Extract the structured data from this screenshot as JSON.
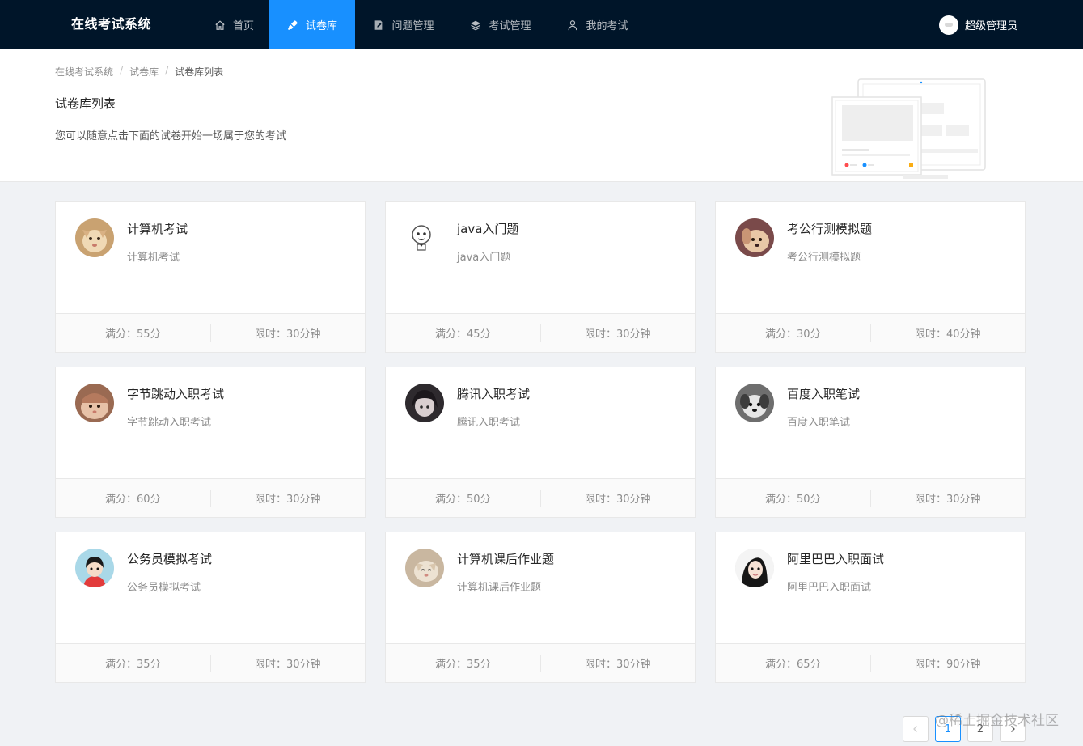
{
  "header": {
    "brand": "在线考试系统",
    "nav": [
      {
        "label": "首页",
        "icon": "home-icon"
      },
      {
        "label": "试卷库",
        "icon": "rocket-icon",
        "active": true
      },
      {
        "label": "问题管理",
        "icon": "edit-doc-icon"
      },
      {
        "label": "考试管理",
        "icon": "stack-icon"
      },
      {
        "label": "我的考试",
        "icon": "user-icon"
      }
    ],
    "user_name": "超级管理员",
    "accent_color": "#1890ff",
    "bar_color": "#001529"
  },
  "breadcrumb": [
    "在线考试系统",
    "试卷库",
    "试卷库列表"
  ],
  "page_title": "试卷库列表",
  "page_desc": "您可以随意点击下面的试卷开始一场属于您的考试",
  "cards": [
    {
      "title": "计算机考试",
      "desc": "计算机考试",
      "score": "满分：55分",
      "time": "限时：30分钟",
      "avatar": "cat-avatar"
    },
    {
      "title": "java入门题",
      "desc": "java入门题",
      "score": "满分：45分",
      "time": "限时：30分钟",
      "avatar": "cartoon-avatar"
    },
    {
      "title": "考公行测模拟题",
      "desc": "考公行测模拟题",
      "score": "满分：30分",
      "time": "限时：40分钟",
      "avatar": "dog-avatar"
    },
    {
      "title": "字节跳动入职考试",
      "desc": "字节跳动入职考试",
      "score": "满分：60分",
      "time": "限时：30分钟",
      "avatar": "hamster-avatar"
    },
    {
      "title": "腾讯入职考试",
      "desc": "腾讯入职考试",
      "score": "满分：50分",
      "time": "限时：30分钟",
      "avatar": "anime-avatar"
    },
    {
      "title": "百度入职笔试",
      "desc": "百度入职笔试",
      "score": "满分：50分",
      "time": "限时：30分钟",
      "avatar": "puppy-avatar"
    },
    {
      "title": "公务员模拟考试",
      "desc": "公务员模拟考试",
      "score": "满分：35分",
      "time": "限时：30分钟",
      "avatar": "girl-avatar"
    },
    {
      "title": "计算机课后作业题",
      "desc": "计算机课后作业题",
      "score": "满分：35分",
      "time": "限时：30分钟",
      "avatar": "kitten-avatar"
    },
    {
      "title": "阿里巴巴入职面试",
      "desc": "阿里巴巴入职面试",
      "score": "满分：65分",
      "time": "限时：90分钟",
      "avatar": "woman-avatar"
    }
  ],
  "pagination": {
    "pages": [
      "1",
      "2"
    ],
    "current": "1"
  },
  "watermark": "@稀土掘金技术社区"
}
